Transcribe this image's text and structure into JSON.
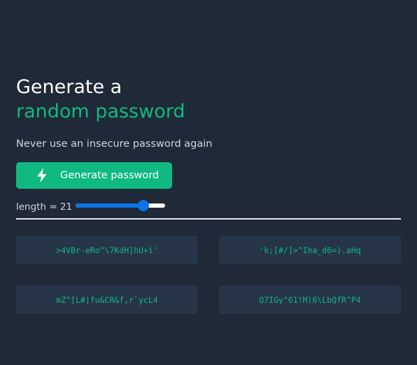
{
  "header": {
    "title_line1": "Generate a",
    "title_line2": "random password",
    "subtitle": "Never use an insecure password again"
  },
  "generate_button": {
    "label": "Generate password",
    "icon": "lightning-bolt-icon"
  },
  "length": {
    "label": "length = 21",
    "value": 21,
    "slider_fraction": 0.76
  },
  "passwords": [
    ">4VBr-eRo^\\7KdH]hU+i'",
    "'k;[#/]>^Iha_d6=).aHq",
    "mZ^[L#|fu&CR&f,r`ycL4",
    "Q7IGy\"61!M)6\\LbQfR^P4"
  ],
  "colors": {
    "background": "#1f2937",
    "accent": "#10b981",
    "card": "#273549",
    "slider": "#0b74e6"
  }
}
